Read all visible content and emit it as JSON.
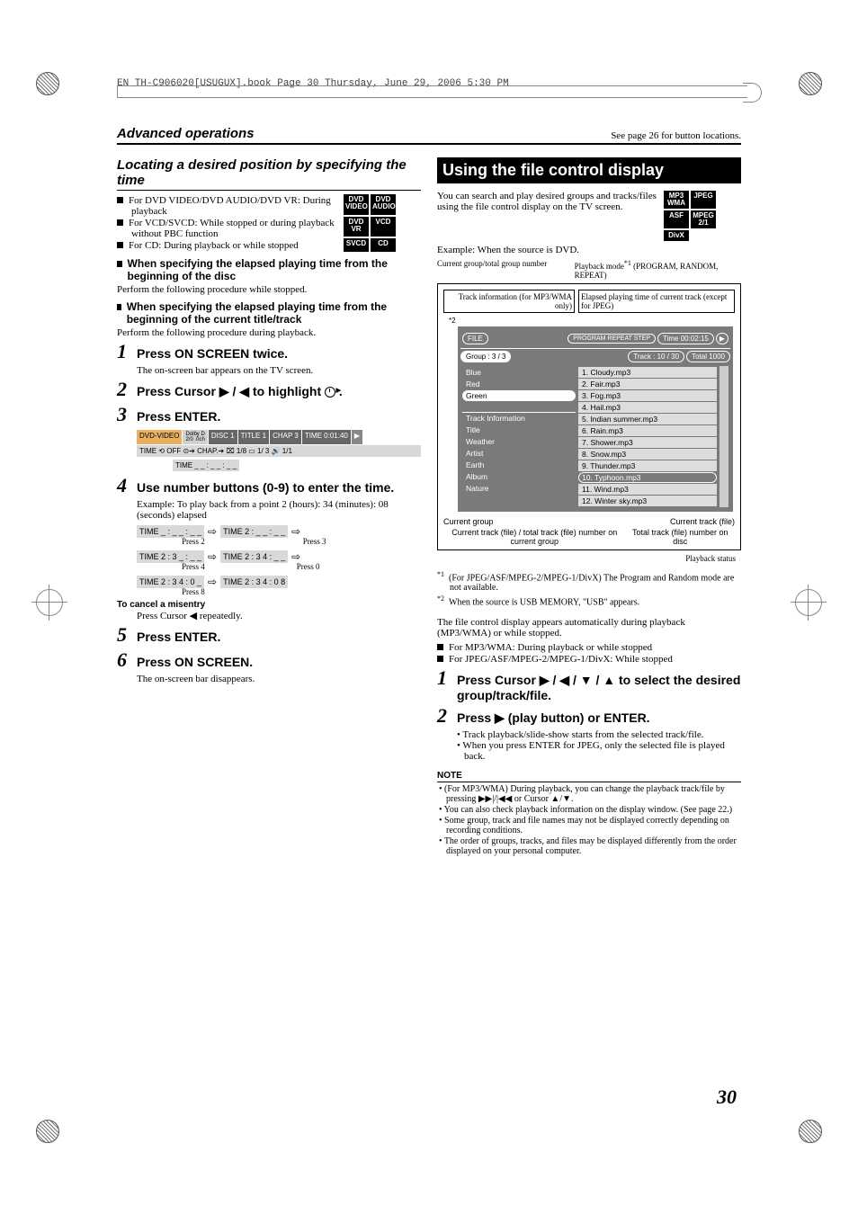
{
  "meta_header": "EN_TH-C906020[USUGUX].book  Page 30  Thursday, June 29, 2006  5:30 PM",
  "top_left": "Advanced operations",
  "top_right": "See page 26 for button locations.",
  "page_number": "30",
  "left": {
    "heading": "Locating a desired position by specifying the time",
    "badges": [
      "DVD\nVIDEO",
      "DVD\nAUDIO",
      "DVD\nVR",
      "VCD",
      "SVCD",
      "CD"
    ],
    "bullets": [
      "For DVD VIDEO/DVD AUDIO/DVD VR: During playback",
      "For VCD/SVCD: While stopped or during playback without PBC function",
      "For CD: During playback or while stopped"
    ],
    "sub1_h": "When specifying the elapsed playing time from the beginning of the disc",
    "sub1_p": "Perform the following procedure while stopped.",
    "sub2_h": "When specifying the elapsed playing time from the beginning of the current title/track",
    "sub2_p": "Perform the following procedure during playback.",
    "step1": "Press ON SCREEN twice.",
    "step1_sub": "The on-screen bar appears on the TV screen.",
    "step2_pre": "Press Cursor ",
    "step2_mid": " / ",
    "step2_post": " to highlight ",
    "step2_end": " .",
    "step3": "Press ENTER.",
    "bar_row1": {
      "a": "DVD-VIDEO",
      "b": "Dolby D\n2/0 .0ch",
      "c": "DISC 1",
      "d": "TITLE  1",
      "e": "CHAP  3",
      "f": "TIME   0:01:40"
    },
    "bar_row2": "TIME ⟲ OFF   ⊙➔  CHAP.➔  ⌧ 1/8  ▭ 1/ 3  🔊 1/1",
    "bar_row3": "TIME  _ _ : _ _ : _ _",
    "step4": "Use number buttons (0-9) to enter the time.",
    "step4_ex": "Example: To play back from a point 2 (hours): 34 (minutes): 08 (seconds) elapsed",
    "flow": [
      {
        "box": "TIME  _ : _ _ : _ _",
        "label": "Press 2"
      },
      {
        "box": "TIME  2 : _ _ : _ _",
        "label": "Press 3"
      },
      {
        "box": "TIME  2 : 3 _ : _ _",
        "label": "Press 4"
      },
      {
        "box": "TIME  2 : 3 4 : _ _",
        "label": "Press 0"
      },
      {
        "box": "TIME  2 : 3 4 : 0 _",
        "label": "Press 8"
      },
      {
        "box": "TIME  2 : 3 4 : 0 8",
        "label": ""
      }
    ],
    "cancel_h": "To cancel a misentry",
    "cancel_p": "Press Cursor ◀ repeatedly.",
    "step5": "Press ENTER.",
    "step6": "Press ON SCREEN.",
    "step6_sub": "The on-screen bar disappears."
  },
  "right": {
    "heading": "Using the file control display",
    "intro": "You can search and play desired groups and tracks/files using the file control display on the TV screen.",
    "badges": [
      "MP3\nWMA",
      "JPEG",
      "ASF",
      "MPEG\n2/1",
      "DivX"
    ],
    "example": "Example: When the source is DVD.",
    "cap_tl": "Current group/total group number",
    "cap_tr_a": "Playback mode",
    "cap_tr_b": " (PROGRAM, RANDOM, REPEAT)",
    "cap_inner_l": "Track information (for MP3/WMA only)",
    "cap_inner_r": "Elapsed playing time of current track (except for JPEG)",
    "fd": {
      "file_tag": "FILE",
      "top_right": "PROGRAM  REPEAT STEP",
      "time": "Time 00:02:15",
      "group": "Group  :   3  /  3",
      "track_head": "Track  :  10  /  30",
      "total": "Total  1000",
      "left_items": [
        "Blue",
        "Red",
        "Green"
      ],
      "info_h": "Track  Information",
      "info_rows": [
        "Title",
        "Weather",
        "Artist",
        "Earth",
        "Album",
        "Nature"
      ],
      "tracks": [
        "1. Cloudy.mp3",
        "2. Fair.mp3",
        "3. Fog.mp3",
        "4. Hail.mp3",
        "5. Indian summer.mp3",
        "6. Rain.mp3",
        "7. Shower.mp3",
        "8. Snow.mp3",
        "9. Thunder.mp3",
        "10. Typhoon.mp3",
        "11. Wind.mp3",
        "12. Winter sky.mp3"
      ]
    },
    "lab_cur_group": "Current group",
    "lab_cur_track": "Current track (file)",
    "lab_bottom_l": "Current track (file) / total track (file) number on current group",
    "lab_bottom_r": "Total track (file) number on disc",
    "lab_status": "Playback status",
    "foot1_pre": "*",
    "foot1": "(For JPEG/ASF/MPEG-2/MPEG-1/DivX) The Program and Random mode are not available.",
    "foot2": "When the source is USB MEMORY, \"USB\" appears.",
    "para": "The file control display appears automatically during playback (MP3/WMA) or while stopped.",
    "b1": "For MP3/WMA: During playback or while stopped",
    "b2": "For JPEG/ASF/MPEG-2/MPEG-1/DivX: While stopped",
    "r_step1_a": "Press Cursor ",
    "r_step1_b": " / ",
    "r_step1_end": " to select the desired group/track/file.",
    "r_step2": "Press ▶ (play button) or ENTER.",
    "r_step2_sub1": "Track playback/slide-show starts from the selected track/file.",
    "r_step2_sub2": "When you press ENTER for JPEG, only the selected file is played back.",
    "note_h": "NOTE",
    "notes": [
      "(For MP3/WMA) During playback, you can change the playback track/file by pressing ▶▶|/|◀◀ or Cursor ▲/▼.",
      "You can also check playback information on the display window. (See page 22.)",
      "Some group, track and file names may not be displayed correctly depending on recording conditions.",
      "The order of groups, tracks, and files may be displayed differently from the order displayed on your personal computer."
    ]
  }
}
